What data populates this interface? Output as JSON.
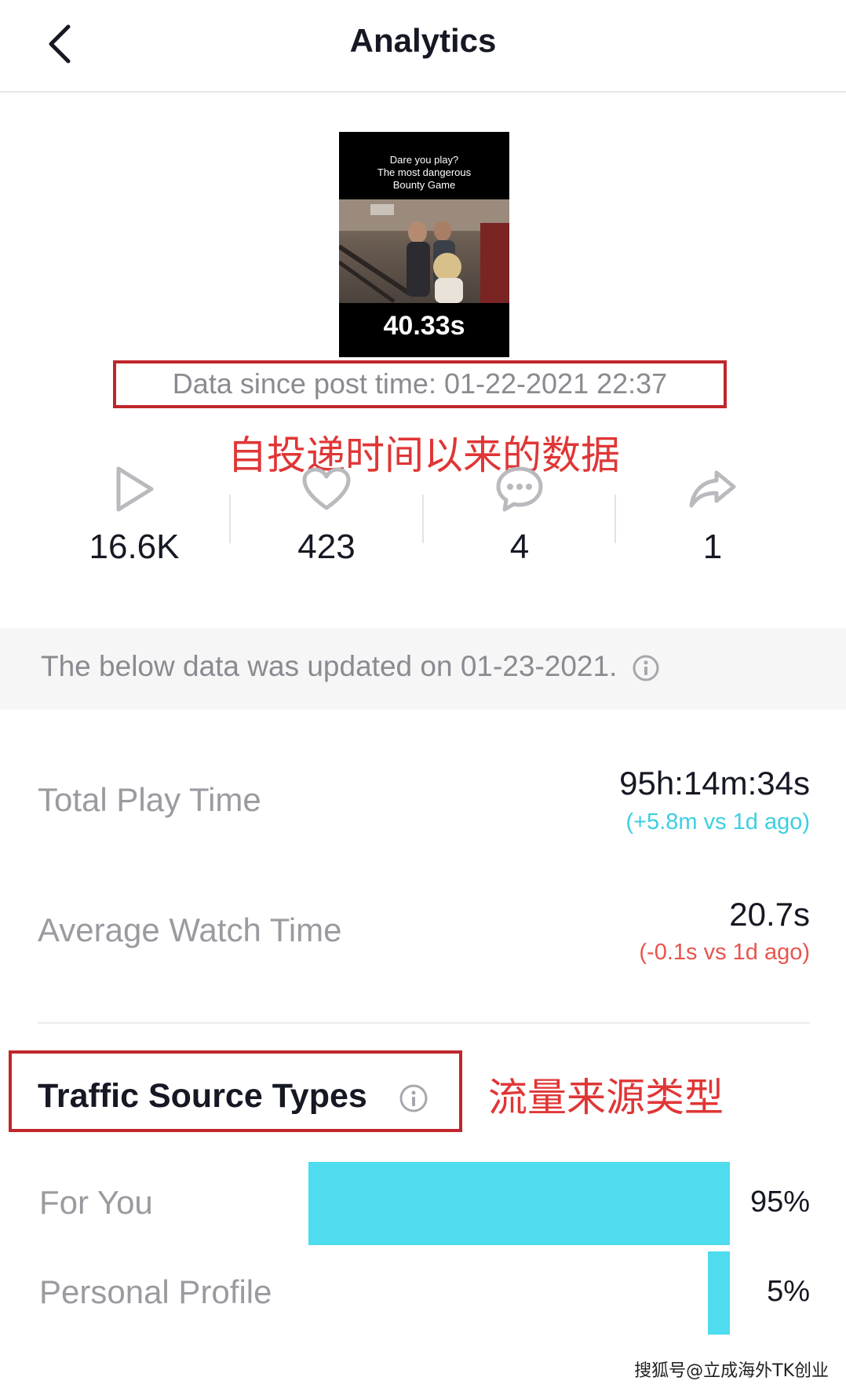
{
  "header": {
    "title": "Analytics"
  },
  "video": {
    "caption_line1": "Dare you play?",
    "caption_line2": "The most dangerous",
    "caption_line3": "Bounty Game",
    "duration": "40.33s"
  },
  "data_since": "Data since post time: 01-22-2021 22:37",
  "annotations": {
    "data_since_cn": "自投递时间以来的数据",
    "traffic_cn": "流量来源类型"
  },
  "stats": [
    {
      "icon": "play-icon",
      "value": "16.6K"
    },
    {
      "icon": "heart-icon",
      "value": "423"
    },
    {
      "icon": "comment-icon",
      "value": "4"
    },
    {
      "icon": "share-icon",
      "value": "1"
    }
  ],
  "updated_notice": "The below data was updated on 01-23-2021.",
  "metrics": {
    "total_play_time": {
      "label": "Total Play Time",
      "value": "95h:14m:34s",
      "delta": "(+5.8m vs 1d ago)",
      "delta_color": "#3ccfe0"
    },
    "avg_watch_time": {
      "label": "Average Watch Time",
      "value": "20.7s",
      "delta": "(-0.1s vs 1d ago)",
      "delta_color": "#e8554e"
    }
  },
  "traffic": {
    "title": "Traffic Source Types",
    "bar_color": "#4fdcee",
    "sources": [
      {
        "label": "For You",
        "percent": 95,
        "display": "95%"
      },
      {
        "label": "Personal Profile",
        "percent": 5,
        "display": "5%"
      }
    ]
  },
  "watermark": "搜狐号@立成海外TK创业"
}
